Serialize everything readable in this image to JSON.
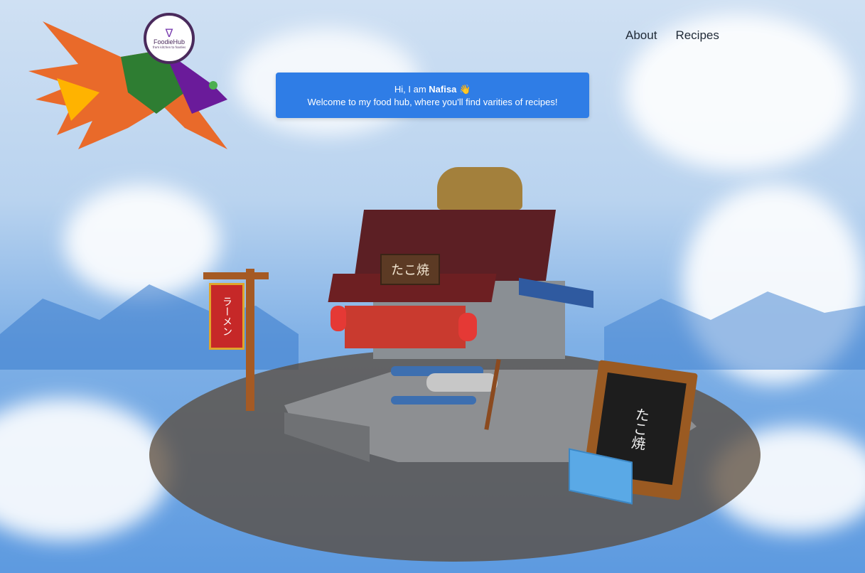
{
  "logo": {
    "name": "FoodieHub",
    "tagline": "from kitchen to foodies",
    "mark": "∇"
  },
  "nav": {
    "items": [
      {
        "label": "About"
      },
      {
        "label": "Recipes"
      }
    ]
  },
  "banner": {
    "greeting_prefix": "Hi, I am",
    "name": "Nafisa",
    "wave_emoji": "👋",
    "subtitle": "Welcome to my food hub, where you'll find varities of recipes!"
  },
  "scene": {
    "shop_sign": "たこ焼",
    "banner_flag": "ラーメン",
    "chalkboard_text": "たこ焼"
  }
}
